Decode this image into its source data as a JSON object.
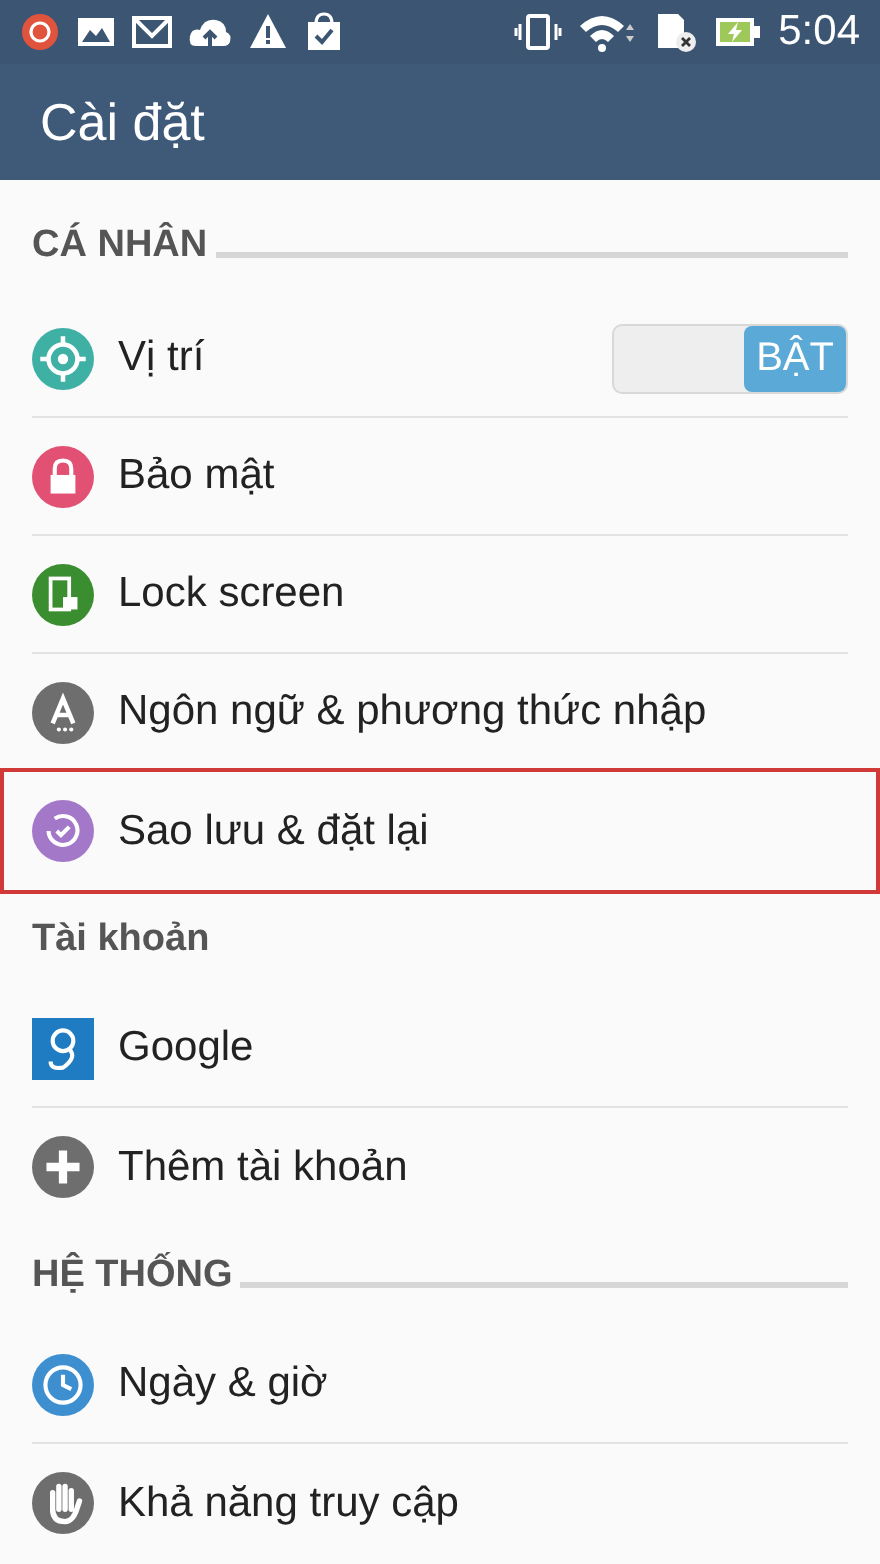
{
  "status_bar": {
    "time": "5:04"
  },
  "app_bar": {
    "title": "Cài đặt"
  },
  "sections": [
    {
      "header": "CÁ NHÂN",
      "rule": true,
      "items": [
        {
          "label": "Vị trí",
          "kind": "toggle",
          "switch": {
            "label": "BẬT",
            "on": true
          },
          "highlighted": false
        },
        {
          "label": "Bảo mật",
          "kind": "plain",
          "highlighted": false
        },
        {
          "label": "Lock screen",
          "kind": "plain",
          "highlighted": false
        },
        {
          "label": "Ngôn ngữ & phương thức nhập",
          "kind": "plain",
          "highlighted": false
        },
        {
          "label": "Sao lưu & đặt lại",
          "kind": "plain",
          "highlighted": true
        }
      ]
    },
    {
      "header": "Tài khoản",
      "rule": false,
      "items": [
        {
          "label": "Google",
          "kind": "plain",
          "highlighted": false
        },
        {
          "label": "Thêm tài khoản",
          "kind": "plain",
          "highlighted": false
        }
      ]
    },
    {
      "header": "HỆ THỐNG",
      "rule": true,
      "items": [
        {
          "label": "Ngày & giờ",
          "kind": "plain",
          "highlighted": false
        },
        {
          "label": "Khả năng truy cập",
          "kind": "plain",
          "highlighted": false
        }
      ]
    }
  ]
}
